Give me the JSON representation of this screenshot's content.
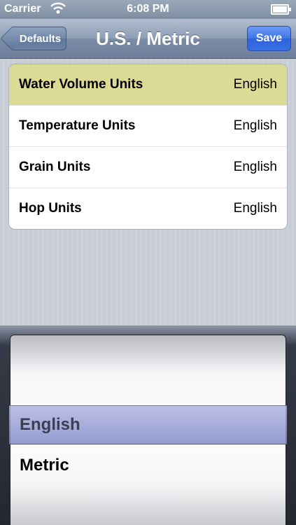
{
  "status_bar": {
    "carrier": "Carrier",
    "time": "6:08 PM",
    "icons": [
      "wifi-icon",
      "battery-icon"
    ]
  },
  "nav": {
    "back_label": "Defaults",
    "title": "U.S. / Metric",
    "save_label": "Save"
  },
  "settings": [
    {
      "label": "Water Volume Units",
      "value": "English",
      "selected": true
    },
    {
      "label": "Temperature Units",
      "value": "English",
      "selected": false
    },
    {
      "label": "Grain Units",
      "value": "English",
      "selected": false
    },
    {
      "label": "Hop Units",
      "value": "English",
      "selected": false
    }
  ],
  "picker": {
    "options": [
      "English",
      "Metric"
    ],
    "selected": "English"
  },
  "colors": {
    "selected_row": "#dcdb95",
    "save_button": "#3e74e6",
    "nav_bar": "#8d9db5"
  }
}
